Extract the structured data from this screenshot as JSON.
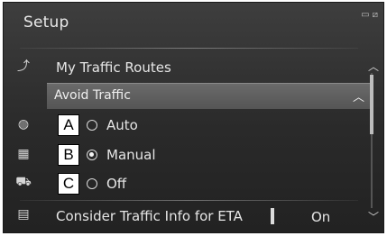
{
  "header": {
    "title": "Setup"
  },
  "status_icons": [
    "signal-icon",
    "no-signal-icon"
  ],
  "menu": {
    "my_traffic_routes": "My Traffic Routes",
    "avoid_traffic": {
      "label": "Avoid Traffic",
      "options": [
        {
          "marker": "A",
          "label": "Auto",
          "selected": false
        },
        {
          "marker": "B",
          "label": "Manual",
          "selected": true
        },
        {
          "marker": "C",
          "label": "Off",
          "selected": false
        }
      ]
    },
    "consider_traffic": {
      "label": "Consider Traffic Info for ETA",
      "value": "On"
    }
  },
  "sidebar_icons": [
    "route-icon",
    "traffic-icon",
    "map-icon",
    "car-icon",
    "settings-icon"
  ]
}
